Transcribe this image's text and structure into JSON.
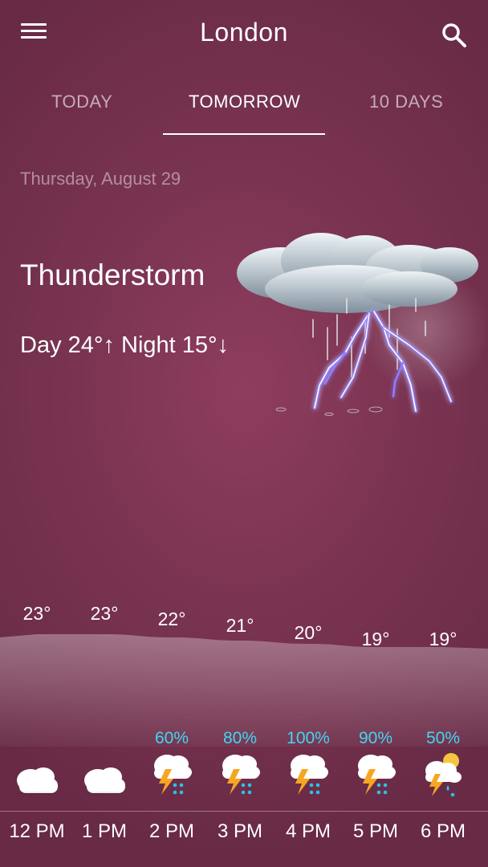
{
  "header": {
    "city": "London",
    "menu_icon": "menu-icon",
    "search_icon": "search-icon"
  },
  "tabs": [
    {
      "label": "TODAY",
      "active": false
    },
    {
      "label": "TOMORROW",
      "active": true
    },
    {
      "label": "10 DAYS",
      "active": false
    }
  ],
  "summary": {
    "date": "Thursday, August 29",
    "condition": "Thunderstorm",
    "day_night": "Day 24°↑  Night 15°↓",
    "icon": "thunderstorm-cloud-icon"
  },
  "hourly": [
    {
      "time": "12 PM",
      "temp": "23°",
      "precip": "",
      "icon": "cloud-icon"
    },
    {
      "time": "1 PM",
      "temp": "23°",
      "precip": "",
      "icon": "cloud-icon"
    },
    {
      "time": "2 PM",
      "temp": "22°",
      "precip": "60%",
      "icon": "thunder-rain-icon"
    },
    {
      "time": "3 PM",
      "temp": "21°",
      "precip": "80%",
      "icon": "thunder-rain-icon"
    },
    {
      "time": "4 PM",
      "temp": "20°",
      "precip": "100%",
      "icon": "thunder-rain-icon"
    },
    {
      "time": "5 PM",
      "temp": "19°",
      "precip": "90%",
      "icon": "thunder-rain-icon"
    },
    {
      "time": "6 PM",
      "temp": "19°",
      "precip": "50%",
      "icon": "sun-thunder-rain-icon"
    }
  ],
  "colors": {
    "background": "#7a3451",
    "precip_text": "#41d6f2",
    "bolt": "#f5a623",
    "sun": "#f5c542",
    "rain_drop": "#2bc1e6"
  }
}
